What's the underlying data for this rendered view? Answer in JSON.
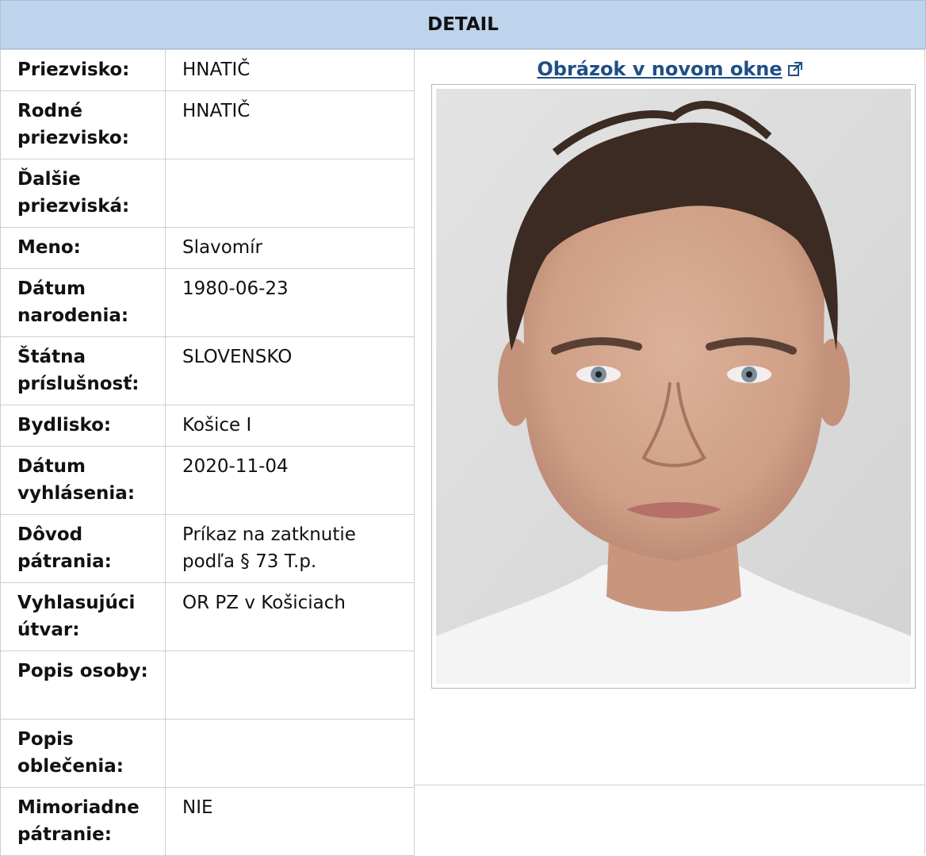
{
  "header": {
    "title": "DETAIL"
  },
  "rows": [
    {
      "label": "Priezvisko:",
      "value": "HNATIČ"
    },
    {
      "label": "Rodné priezvisko:",
      "value": "HNATIČ"
    },
    {
      "label": "Ďalšie priezviská:",
      "value": ""
    },
    {
      "label": "Meno:",
      "value": "Slavomír"
    },
    {
      "label": "Dátum narodenia:",
      "value": "1980-06-23"
    },
    {
      "label": "Štátna príslušnosť:",
      "value": "SLOVENSKO"
    },
    {
      "label": "Bydlisko:",
      "value": "Košice I"
    },
    {
      "label": "Dátum vyhlásenia:",
      "value": "2020-11-04"
    },
    {
      "label": "Dôvod pátrania:",
      "value": "Príkaz na zatknutie podľa § 73 T.p."
    },
    {
      "label": "Vyhlasujúci útvar:",
      "value": "OR PZ v Košiciach"
    },
    {
      "label": "Popis osoby:",
      "value": ""
    },
    {
      "label": "Popis oblečenia:",
      "value": ""
    },
    {
      "label": "Mimoriadne pátranie:",
      "value": "NIE"
    }
  ],
  "photo": {
    "link_label": "Obrázok v novom okne",
    "link_icon": "external-link-icon",
    "image_icon": "person-portrait-photo"
  },
  "colors": {
    "header_bg": "#bcd4ec",
    "link": "#1f4f85",
    "border": "#cfcfcf"
  }
}
